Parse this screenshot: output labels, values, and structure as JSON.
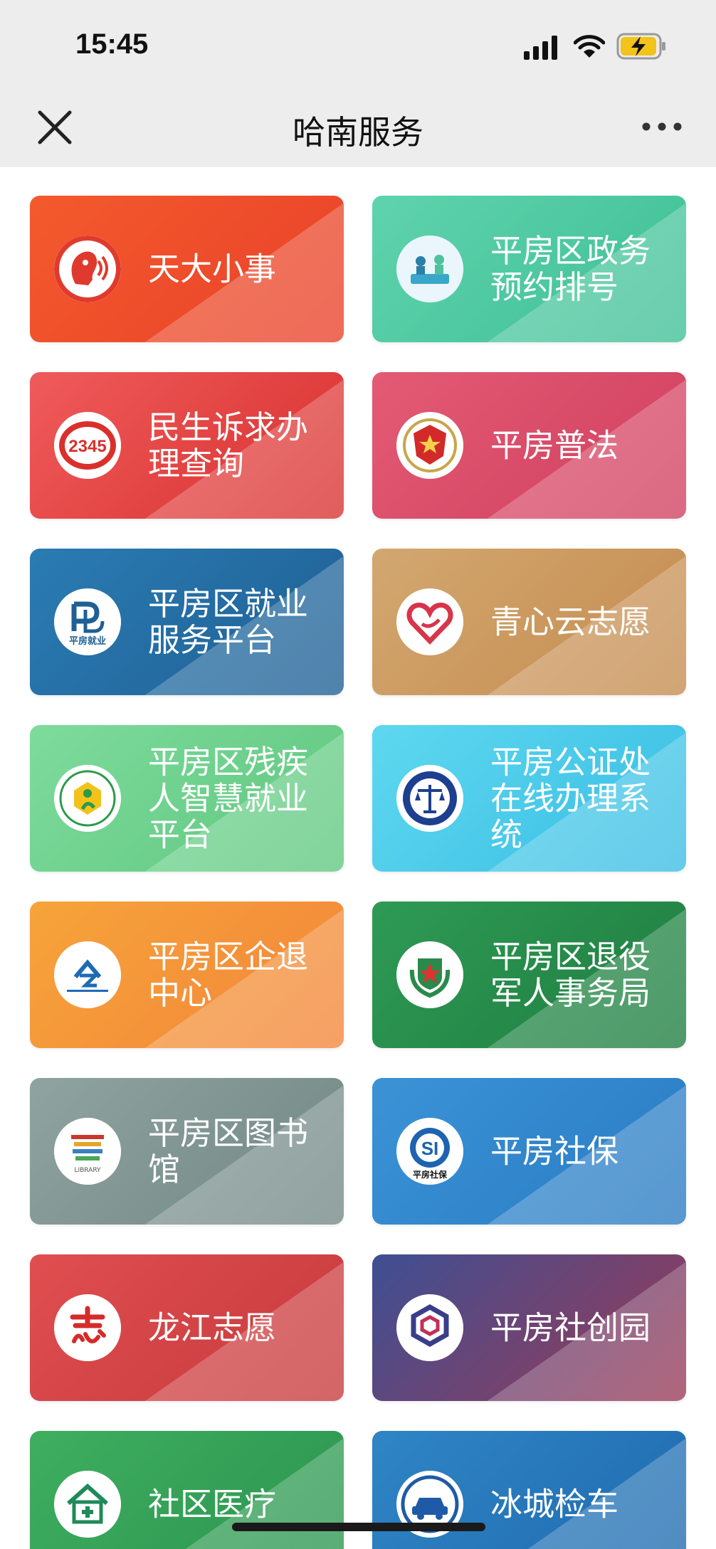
{
  "status_bar": {
    "time": "15:45"
  },
  "nav": {
    "title": "哈南服务"
  },
  "colors": {
    "nav_bg": "#ededed",
    "card_text": "#ffffff"
  },
  "cards": [
    {
      "label": "天大小事",
      "icon": "speech-head-icon",
      "bg": [
        "#f45a2c",
        "#e8412a"
      ]
    },
    {
      "label": "平房区政务预约排号",
      "icon": "government-service-icon",
      "bg": [
        "#5fd3ad",
        "#3fbf95"
      ]
    },
    {
      "label": "民生诉求办理查询",
      "icon": "hotline-12345-icon",
      "bg": [
        "#ef5b5b",
        "#d8312f"
      ]
    },
    {
      "label": "平房普法",
      "icon": "police-emblem-icon",
      "bg": [
        "#e45a74",
        "#d04060"
      ]
    },
    {
      "label": "平房区就业服务平台",
      "icon": "employment-logo-icon",
      "bg": [
        "#2a7cb3",
        "#1f5f94"
      ]
    },
    {
      "label": "青心云志愿",
      "icon": "heart-hand-icon",
      "bg": [
        "#d2a870",
        "#c58b4f"
      ]
    },
    {
      "label": "平房区残疾人智慧就业平台",
      "icon": "disabled-federation-icon",
      "bg": [
        "#7edb9c",
        "#5fc77f"
      ]
    },
    {
      "label": "平房公证处在线办理系统",
      "icon": "notary-scales-icon",
      "bg": [
        "#5ed8f0",
        "#39bde3"
      ]
    },
    {
      "label": "平房区企退中心",
      "icon": "retirement-center-icon",
      "bg": [
        "#f6a43a",
        "#f3853a"
      ]
    },
    {
      "label": "平房区退役军人事务局",
      "icon": "veterans-star-icon",
      "bg": [
        "#2e9a55",
        "#1f7d40"
      ]
    },
    {
      "label": "平房区图书馆",
      "icon": "library-logo-icon",
      "bg": [
        "#8fa3a0",
        "#728885"
      ]
    },
    {
      "label": "平房社保",
      "icon": "social-security-icon",
      "bg": [
        "#3b93d6",
        "#2a7bc2"
      ]
    },
    {
      "label": "龙江志愿",
      "icon": "volunteer-zhi-icon",
      "bg": [
        "#e04e50",
        "#c63a3c"
      ]
    },
    {
      "label": "平房社创园",
      "icon": "hexagon-logo-icon",
      "bg": [
        "#3e4f93",
        "#9b3a55"
      ]
    },
    {
      "label": "社区医疗",
      "icon": "community-medical-icon",
      "bg": [
        "#3fae5f",
        "#2b9450"
      ]
    },
    {
      "label": "冰城检车",
      "icon": "car-inspection-icon",
      "bg": [
        "#2f85c5",
        "#1f6aae"
      ]
    }
  ]
}
